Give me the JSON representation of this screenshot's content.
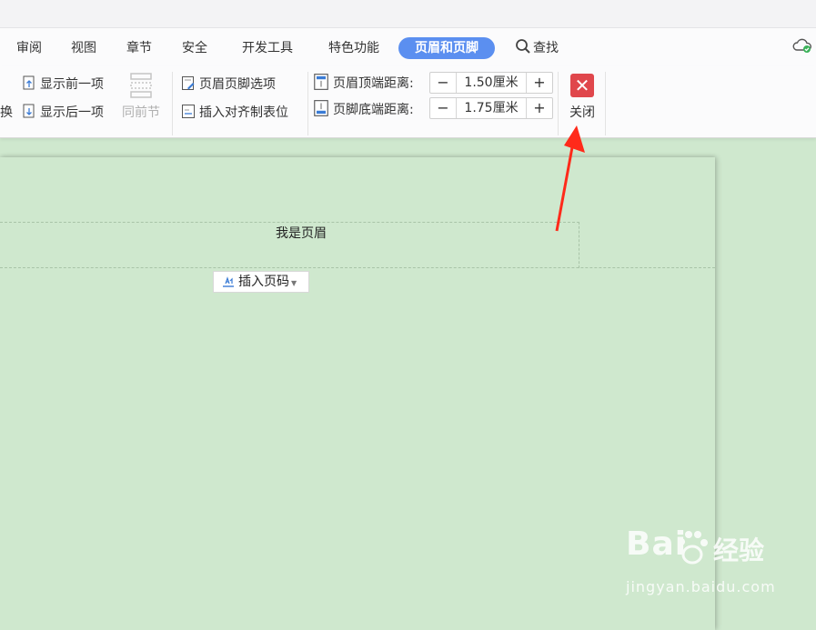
{
  "tabs": [
    {
      "label": "审阅"
    },
    {
      "label": "视图"
    },
    {
      "label": "章节"
    },
    {
      "label": "安全"
    },
    {
      "label": "开发工具"
    },
    {
      "label": "特色功能"
    },
    {
      "label": "页眉和页脚",
      "active": true
    }
  ],
  "search_label": "查找",
  "ribbon": {
    "partial_label": "换",
    "show_prev": "显示前一项",
    "show_next": "显示后一项",
    "same_as_prev": "同前节",
    "header_footer_options": "页眉页脚选项",
    "insert_align_tab": "插入对齐制表位",
    "header_top_label": "页眉顶端距离:",
    "header_top_value": "1.50厘米",
    "footer_bottom_label": "页脚底端距离:",
    "footer_bottom_value": "1.75厘米",
    "minus": "−",
    "plus": "+",
    "close_label": "关闭"
  },
  "document": {
    "header_text": "我是页眉",
    "insert_page_number": "插入页码"
  },
  "watermark": {
    "brand": "Bai",
    "brand_cn": "经验",
    "url": "jingyan.baidu.com"
  },
  "colors": {
    "accent": "#5b8ff0",
    "close_red": "#e0474c",
    "annotation_arrow": "#ff2a1a",
    "page_bg": "#cfe8ce"
  }
}
